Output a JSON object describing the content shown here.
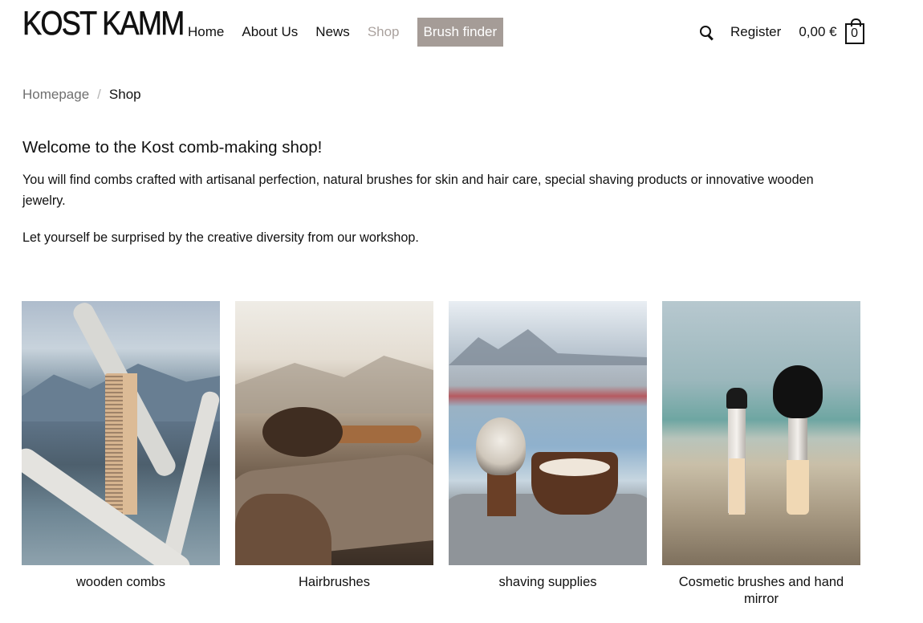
{
  "header": {
    "logo": "KOST KAMM",
    "nav": [
      {
        "label": "Home",
        "muted": false
      },
      {
        "label": "About Us",
        "muted": false
      },
      {
        "label": "News",
        "muted": false
      },
      {
        "label": "Shop",
        "muted": true
      }
    ],
    "finder_label": "Brush finder",
    "register_label": "Register",
    "cart_total": "0,00 €",
    "cart_count": "0"
  },
  "breadcrumb": {
    "home": "Homepage",
    "separator": "/",
    "current": "Shop"
  },
  "content": {
    "title": "Welcome to the Kost comb-making shop!",
    "intro": "You will find combs crafted with artisanal perfection, natural brushes for skin and hair care, special shaving products or innovative wooden jewelry.",
    "intro2": "Let yourself be surprised by the creative diversity from our workshop."
  },
  "categories": [
    {
      "label": "wooden combs"
    },
    {
      "label": "Hairbrushes"
    },
    {
      "label": "shaving supplies"
    },
    {
      "label": "Cosmetic brushes and hand mirror"
    }
  ],
  "colors": {
    "accent": "#a59c97",
    "muted_text": "#aaa29e",
    "text": "#111111"
  }
}
